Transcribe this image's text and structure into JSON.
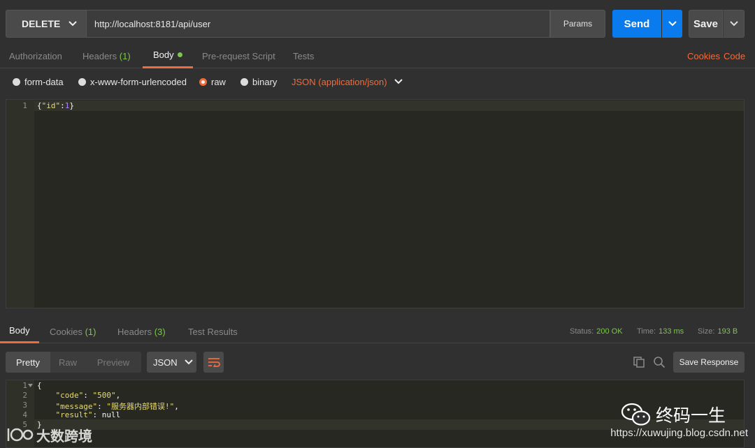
{
  "request": {
    "method": "DELETE",
    "url": "http://localhost:8181/api/user",
    "params_label": "Params",
    "send_label": "Send",
    "save_label": "Save"
  },
  "request_tabs": [
    {
      "label": "Authorization"
    },
    {
      "label": "Headers",
      "count": "(1)"
    },
    {
      "label": "Body"
    },
    {
      "label": "Pre-request Script"
    },
    {
      "label": "Tests"
    }
  ],
  "request_links": {
    "cookies": "Cookies",
    "code": "Code"
  },
  "body_types": [
    {
      "label": "form-data",
      "selected": false
    },
    {
      "label": "x-www-form-urlencoded",
      "selected": false
    },
    {
      "label": "raw",
      "selected": true
    },
    {
      "label": "binary",
      "selected": false
    }
  ],
  "content_type": "JSON (application/json)",
  "request_body": {
    "line_number": "1",
    "key": "\"id\"",
    "value": "1"
  },
  "response_tabs": [
    {
      "label": "Body"
    },
    {
      "label": "Cookies",
      "count": "(1)"
    },
    {
      "label": "Headers",
      "count": "(3)"
    },
    {
      "label": "Test Results"
    }
  ],
  "response_status": {
    "status_label": "Status:",
    "status_value": "200 OK",
    "time_label": "Time:",
    "time_value": "133 ms",
    "size_label": "Size:",
    "size_value": "193 B"
  },
  "response_view": {
    "modes": [
      "Pretty",
      "Raw",
      "Preview"
    ],
    "format": "JSON",
    "save_response": "Save Response"
  },
  "response_body": {
    "line_numbers": [
      "1",
      "2",
      "3",
      "4",
      "5"
    ],
    "code_key": "\"code\"",
    "code_value": "\"500\"",
    "message_key": "\"message\"",
    "message_value": "\"服务器内部错误!\"",
    "result_key": "\"result\"",
    "result_value": "null"
  },
  "watermarks": {
    "left": "大数跨境",
    "right": "终码一生",
    "url": "https://xuwujing.blog.csdn.net"
  },
  "colors": {
    "accent": "#f26b3a",
    "send": "#097bed",
    "success": "#7cc84b"
  }
}
